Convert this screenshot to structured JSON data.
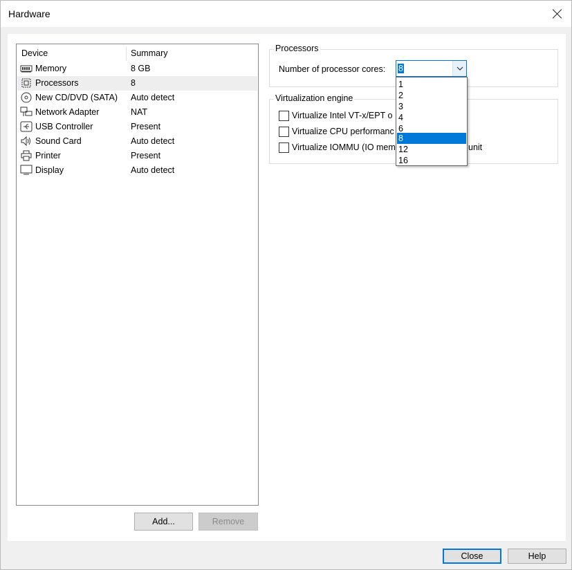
{
  "window": {
    "title": "Hardware"
  },
  "device_list": {
    "headers": {
      "device": "Device",
      "summary": "Summary"
    },
    "rows": [
      {
        "name": "Memory",
        "summary": "8 GB",
        "icon": "memory-icon"
      },
      {
        "name": "Processors",
        "summary": "8",
        "icon": "processor-icon",
        "selected": true
      },
      {
        "name": "New CD/DVD (SATA)",
        "summary": "Auto detect",
        "icon": "cd-dvd-icon"
      },
      {
        "name": "Network Adapter",
        "summary": "NAT",
        "icon": "network-adapter-icon"
      },
      {
        "name": "USB Controller",
        "summary": "Present",
        "icon": "usb-icon"
      },
      {
        "name": "Sound Card",
        "summary": "Auto detect",
        "icon": "speaker-icon"
      },
      {
        "name": "Printer",
        "summary": "Present",
        "icon": "printer-icon"
      },
      {
        "name": "Display",
        "summary": "Auto detect",
        "icon": "monitor-icon"
      }
    ],
    "add_label": "Add...",
    "remove_label": "Remove"
  },
  "processors": {
    "group_label": "Processors",
    "cores_label": "Number of processor cores:",
    "cores_value": "8",
    "options": [
      "1",
      "2",
      "3",
      "4",
      "6",
      "8",
      "12",
      "16"
    ],
    "selected_option": "8"
  },
  "virtualization": {
    "group_label": "Virtualization engine",
    "options": [
      {
        "label": "Virtualize Intel VT-x/EPT o",
        "checked": false
      },
      {
        "label": "Virtualize CPU performanc",
        "checked": false
      },
      {
        "label": "Virtualize IOMMU (IO mem",
        "tail": "unit",
        "checked": false
      }
    ]
  },
  "footer": {
    "close_label": "Close",
    "help_label": "Help"
  },
  "colors": {
    "accent": "#0078d7",
    "selected_row": "#eeeeee",
    "window_bg": "#f0f0f0"
  }
}
